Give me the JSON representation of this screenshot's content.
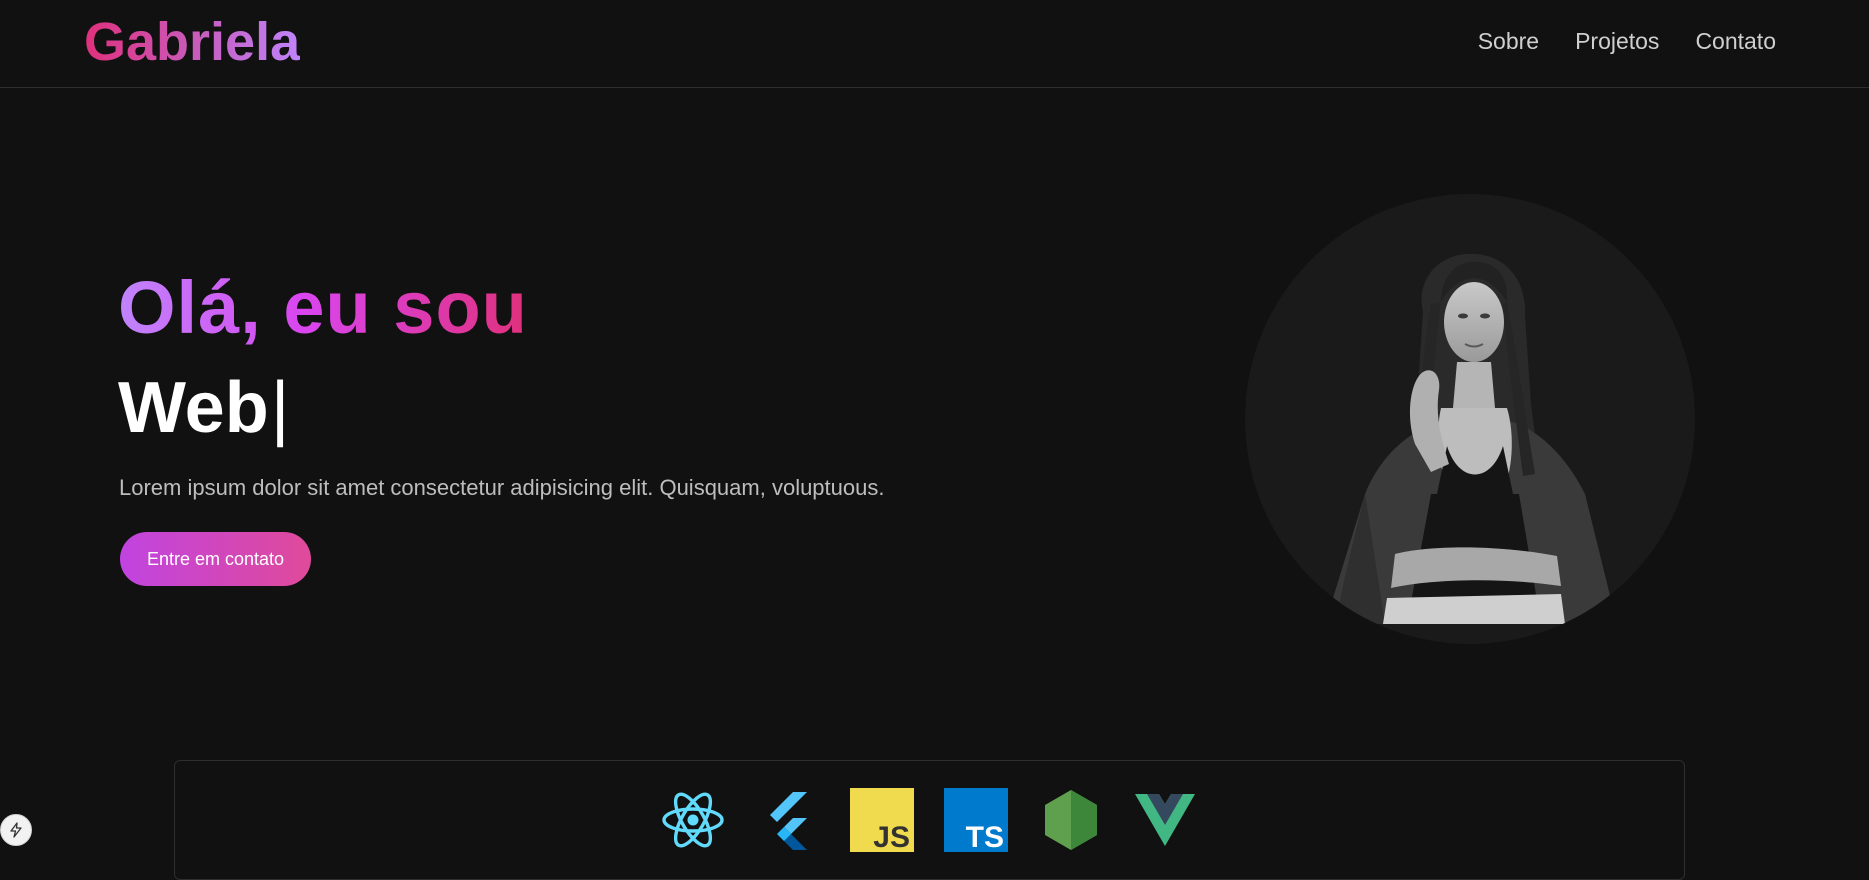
{
  "header": {
    "logo": "Gabriela",
    "nav": [
      "Sobre",
      "Projetos",
      "Contato"
    ]
  },
  "hero": {
    "greeting": "Olá, eu sou",
    "role": "Web",
    "cursor": "|",
    "description": "Lorem ipsum dolor sit amet consectetur adipisicing elit. Quisquam, voluptuous.",
    "cta_label": "Entre em contato"
  },
  "portrait": {
    "alt": "Gabriela"
  },
  "tech": {
    "icons": [
      "react-icon",
      "flutter-icon",
      "javascript-icon",
      "typescript-icon",
      "nodejs-icon",
      "vue-icon"
    ],
    "js_label": "JS",
    "ts_label": "TS"
  },
  "colors": {
    "background": "#111111",
    "accent_pink": "#e0307c",
    "accent_purple": "#c084fc",
    "text_muted": "#bdbdbd"
  }
}
